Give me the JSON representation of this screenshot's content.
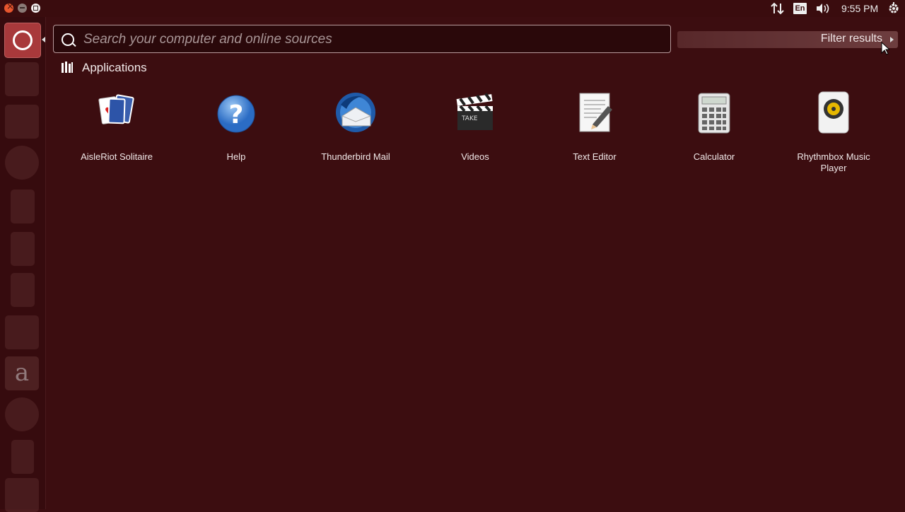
{
  "panel": {
    "keyboard_layout": "En",
    "clock": "9:55 PM",
    "icons": [
      "network-icon",
      "keyboard-layout-icon",
      "sound-icon",
      "system-gear-icon"
    ]
  },
  "search": {
    "placeholder": "Search your computer and online sources"
  },
  "filter": {
    "label": "Filter results"
  },
  "category": {
    "label": "Applications"
  },
  "apps": [
    {
      "label": "AisleRiot Solitaire",
      "icon": "solitaire-cards-icon"
    },
    {
      "label": "Help",
      "icon": "help-icon"
    },
    {
      "label": "Thunderbird Mail",
      "icon": "thunderbird-icon"
    },
    {
      "label": "Videos",
      "icon": "clapperboard-icon"
    },
    {
      "label": "Text Editor",
      "icon": "text-editor-icon"
    },
    {
      "label": "Calculator",
      "icon": "calculator-icon"
    },
    {
      "label": "Rhythmbox Music Player",
      "icon": "speaker-icon"
    }
  ],
  "launcher": {
    "items": [
      "dash-home-icon",
      "files-icon",
      "browser-icon",
      "firefox-icon",
      "writer-icon",
      "calc-icon",
      "impress-icon",
      "software-center-icon",
      "amazon-icon",
      "settings-icon",
      "workspace-icon",
      "trash-icon"
    ],
    "amazon_glyph": "a"
  },
  "colors": {
    "background": "#3c0d10",
    "accent": "#a8393b"
  }
}
